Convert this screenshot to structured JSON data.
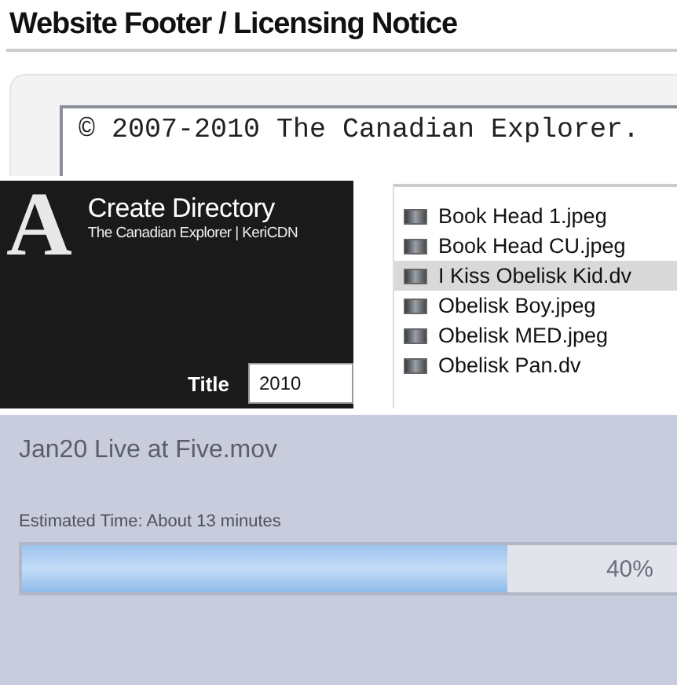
{
  "footer_notice": {
    "heading": "Website Footer / Licensing Notice",
    "text": "© 2007-2010 The Canadian Explorer."
  },
  "create_directory": {
    "logo": "A",
    "title": "Create Directory",
    "subtitle": "The Canadian Explorer | KeriCDN",
    "field_label": "Title",
    "field_value": "2010"
  },
  "file_list": [
    {
      "name": "Book Head 1.jpeg",
      "selected": false
    },
    {
      "name": "Book Head CU.jpeg",
      "selected": false
    },
    {
      "name": "I Kiss Obelisk Kid.dv",
      "selected": true
    },
    {
      "name": "Obelisk Boy.jpeg",
      "selected": false
    },
    {
      "name": "Obelisk MED.jpeg",
      "selected": false
    },
    {
      "name": "Obelisk Pan.dv",
      "selected": false
    }
  ],
  "export_progress": {
    "file": "Jan20 Live at Five.mov",
    "estimate": "Estimated Time: About 13 minutes",
    "level": 0.74,
    "reading": "40%"
  }
}
